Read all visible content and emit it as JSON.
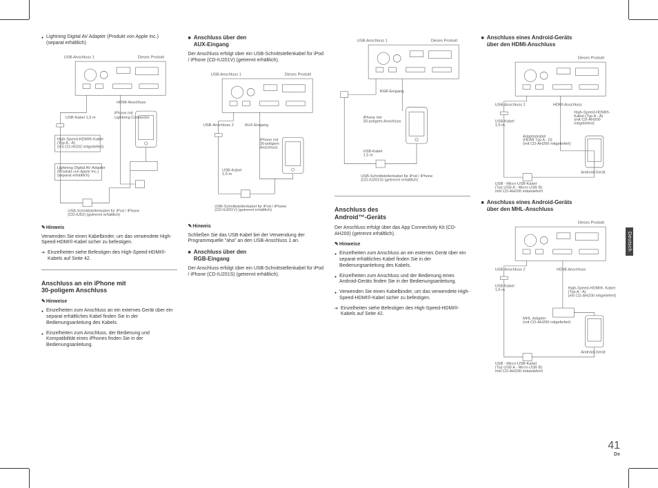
{
  "page": {
    "number": "41",
    "langCode": "De",
    "tabLabel": "Deutsch"
  },
  "col1": {
    "bullet1": "Lightning Digital AV Adapter (Produkt von Apple Inc.) (separat erhältlich)",
    "diag1": {
      "usbPort1": "USB-Anschluss 1",
      "thisProduct": "Dieses Produkt",
      "hdmiPort": "HDMI-Anschluss",
      "usbCable": "USB-Kabel 1,5 m",
      "iphoneLightning": "iPhone mit Lightning Connector",
      "hdmiCable": "High-Speed-HDMI®-Kabel (Typ A - A) (mit CD-IH202 mitgeliefert)",
      "avAdapter": "Lightning Digital AV Adapter (Produkt von Apple Inc.) (separat erhältlich)",
      "usbInterface": "USB-Schnittstellenkabel für iPod / iPhone (CD-IU52) (getrennt erhältlich)"
    },
    "noteLabel": "Hinweis",
    "noteText": "Verwenden Sie einen Kabelbinder, um das verwendete High-Speed-HDMI®-Kabel sicher zu befestigen.",
    "arrow1": "Einzelheiten siehe Befestigen des High-Speed-HDMI®-Kabels auf Seite 42.",
    "heading2a": "Anschluss an ein iPhone mit",
    "heading2b": "30-poligem Anschluss",
    "notesLabel": "Hinweise",
    "bullet2": "Einzelheiten zum Anschluss an ein externes Gerät über ein separat erhältliches Kabel finden Sie in der Bedienungsanleitung des Kabels.",
    "bullet3": "Einzelheiten zum Anschluss, der Bedienung und Kompatibilität eines iPhones finden Sie in der Bedienungsanleitung."
  },
  "col2": {
    "subHead1a": "Anschluss über den",
    "subHead1b": "AUX-Eingang",
    "para1": "Der Anschluss erfolgt über ein USB-Schnittstellenkabel für iPod / iPhone (CD-IU201V) (getrennt erhältlich).",
    "diag1": {
      "usbPort1": "USB-Anschluss 1",
      "thisProduct": "Dieses Produkt",
      "usbPort2": "USB-Anschluss 2",
      "auxIn": "AUX-Eingang",
      "iphone30pin": "iPhone mit 30-poligem Anschluss",
      "usbCable": "USB-Kabel 1,5 m",
      "usbInterface": "USB-Schnittstellenkabel für iPod / iPhone (CD-IU201V) (getrennt erhältlich)"
    },
    "noteLabel": "Hinweis",
    "noteText": "Schließen Sie das USB-Kabel bei der Verwendung der Programmquelle \"aha\" an den USB-Anschluss 1 an.",
    "subHead2a": "Anschluss über den",
    "subHead2b": "RGB-Eingang",
    "para2": "Der Anschluss erfolgt über ein USB-Schnittstellenkabel für iPod / iPhone (CD-IU201S) (getrennt erhältlich)."
  },
  "col3": {
    "diag1": {
      "usbPort1": "USB-Anschluss 1",
      "thisProduct": "Dieses Produkt",
      "rgbIn": "RGB-Eingang",
      "iphone30pin": "iPhone mit 30-poligem Anschluss",
      "usbCable": "USB-Kabel 1,5 m",
      "usbInterface": "USB-Schnittstellenkabel für iPod / iPhone (CD-IU201S) (getrennt erhältlich)"
    },
    "heading1a": "Anschluss des",
    "heading1b": "Android™-Geräts",
    "para1": "Der Anschluss erfolgt über das App Connectivity Kit (CD-AH200) (getrennt erhältlich).",
    "notesLabel": "Hinweise",
    "bullet1": "Einzelheiten zum Anschluss an ein externes Gerät über ein separat erhältliches Kabel finden Sie in der Bedienungsanleitung des Kabels.",
    "bullet2": "Einzelheiten zum Anschluss und der Bedienung eines Android-Geräts finden Sie in der Bedienungsanleitung.",
    "bullet3": "Verwenden Sie einen Kabelbinder, um das verwendete High-Speed-HDMI®-Kabel sicher zu befestigen.",
    "arrow1": "Einzelheiten siehe Befestigen des High-Speed-HDMI®-Kabels auf Seite 42."
  },
  "col4": {
    "subHead1a": "Anschluss eines Android-Geräts",
    "subHead1b": "über den HDMI-Anschluss",
    "diag1": {
      "thisProduct": "Dieses Produkt",
      "usbPort2": "USB-Anschluss 2",
      "hdmiPort": "HDMI-Anschluss",
      "usbCable": "USB-Kabel 1,5 m",
      "hdmiCable": "High-Speed-HDMI®-Kabel (Typ A - A) (mit CD-AH200 mitgeliefert)",
      "adapterCable": "Adapterkabel (HDMI Typ A - D) (mit CD-AH200 mitgeliefert)",
      "microUsb": "USB - Micro-USB-Kabel (Typ USB A - Micro-USB B) (mit CD-AH200 mitgeliefert)",
      "androidDevice": "Android-Gerät"
    },
    "subHead2a": "Anschluss eines Android-Geräts",
    "subHead2b": "über den MHL-Anschluss",
    "diag2": {
      "thisProduct": "Dieses Produkt",
      "usbPort2": "USB-Anschluss 2",
      "hdmiPort": "HDMI-Anschluss",
      "usbCable": "USB-Kabel 1,5 m",
      "hdmiCable": "High-Speed-HDMI®-Kabel (Typ A - A) (mit CD-AH200 mitgeliefert)",
      "mhlAdapter": "MHL-Adapter (mit CD-AH200 mitgeliefert)",
      "microUsb": "USB - Micro-USB-Kabel (Typ USB A - Micro-USB B) (mit CD-AH200 mitgeliefert)",
      "androidDevice": "Android-Gerät"
    }
  }
}
